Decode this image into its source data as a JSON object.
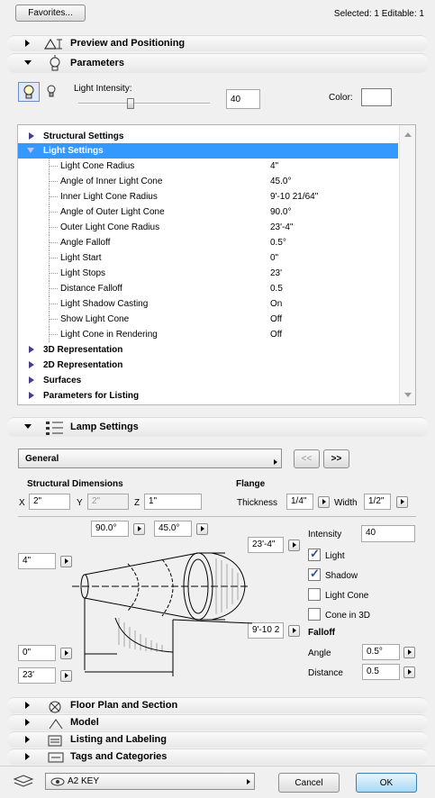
{
  "top": {
    "favorites_label": "Favorites...",
    "selection_status": "Selected: 1 Editable: 1"
  },
  "sections": {
    "preview": "Preview and Positioning",
    "parameters": "Parameters",
    "lamp_settings": "Lamp Settings",
    "floor_plan": "Floor Plan and Section",
    "model": "Model",
    "listing": "Listing and Labeling",
    "tags": "Tags and Categories"
  },
  "parameters": {
    "light_intensity_label": "Light Intensity:",
    "light_intensity_value": "40",
    "light_intensity_slider_fraction": 0.4,
    "color_label": "Color:"
  },
  "tree": {
    "groups_before": [
      {
        "label": "Structural Settings"
      }
    ],
    "selected_group": "Light Settings",
    "rows": [
      {
        "name": "Light Cone Radius",
        "value": "4\""
      },
      {
        "name": "Angle of Inner Light Cone",
        "value": "45.0°"
      },
      {
        "name": "Inner Light Cone Radius",
        "value": "9'-10 21/64\""
      },
      {
        "name": "Angle of Outer Light Cone",
        "value": "90.0°"
      },
      {
        "name": "Outer Light Cone Radius",
        "value": "23'-4\""
      },
      {
        "name": "Angle Falloff",
        "value": "0.5°"
      },
      {
        "name": "Light Start",
        "value": "0\""
      },
      {
        "name": "Light Stops",
        "value": "23'"
      },
      {
        "name": "Distance Falloff",
        "value": "0.5"
      },
      {
        "name": "Light Shadow Casting",
        "value": "On"
      },
      {
        "name": "Show Light Cone",
        "value": "Off"
      },
      {
        "name": "Light Cone in Rendering",
        "value": "Off"
      }
    ],
    "groups_after": [
      {
        "label": "3D Representation"
      },
      {
        "label": "2D Representation"
      },
      {
        "label": "Surfaces"
      },
      {
        "label": "Parameters for Listing"
      }
    ]
  },
  "lamp": {
    "page_select": "General",
    "prev_label": "<<",
    "next_label": ">>",
    "structural_title": "Structural Dimensions",
    "flange_title": "Flange",
    "x_label": "X",
    "x_value": "2\"",
    "y_label": "Y",
    "y_value": "2\"",
    "z_label": "Z",
    "z_value": "1\"",
    "thickness_label": "Thickness",
    "thickness_value": "1/4\"",
    "width_label": "Width",
    "width_value": "1/2\"",
    "angle_outer": "90.0°",
    "angle_inner": "45.0°",
    "outer_radius": "23'-4\"",
    "inner_radius": "9'-10 2",
    "cone_radius": "4\"",
    "light_start": "0\"",
    "light_stop": "23'",
    "intensity_label": "Intensity",
    "intensity_value": "40",
    "cb_light": "Light",
    "cb_shadow": "Shadow",
    "cb_lightcone": "Light Cone",
    "cb_cone3d": "Cone in 3D",
    "falloff_title": "Falloff",
    "angle_label": "Angle",
    "angle_value": "0.5°",
    "distance_label": "Distance",
    "distance_value": "0.5"
  },
  "bottom": {
    "layer": "A2 KEY",
    "cancel_label": "Cancel",
    "ok_label": "OK"
  }
}
